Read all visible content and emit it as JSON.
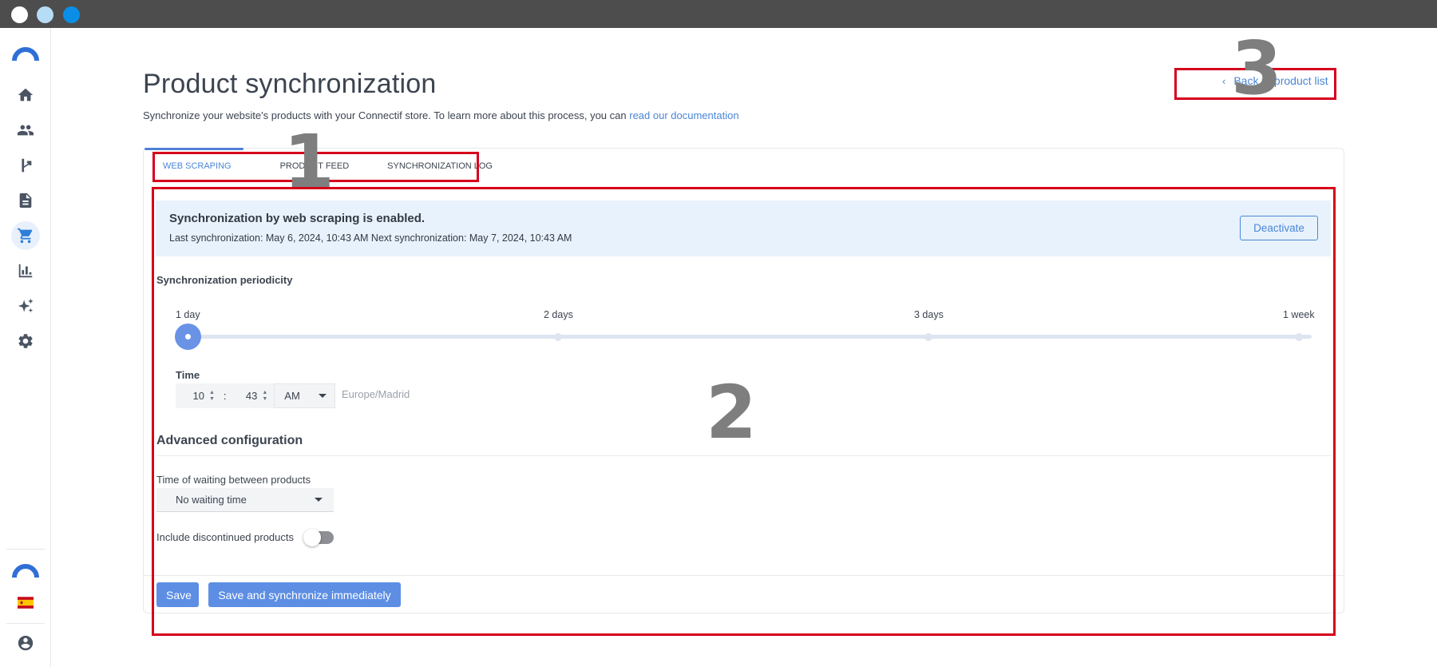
{
  "window": {
    "buttons": [
      "close",
      "minimize",
      "maximize"
    ]
  },
  "sidebar": {
    "items": [
      {
        "icon": "home-icon"
      },
      {
        "icon": "people-icon"
      },
      {
        "icon": "flow-icon"
      },
      {
        "icon": "document-icon"
      },
      {
        "icon": "cart-icon",
        "active": true
      },
      {
        "icon": "chart-icon"
      },
      {
        "icon": "sparkle-icon"
      },
      {
        "icon": "gear-icon"
      }
    ],
    "bottom": [
      {
        "icon": "brand-logo-icon"
      },
      {
        "icon": "spain-flag-icon"
      },
      {
        "icon": "user-avatar-icon"
      }
    ]
  },
  "header": {
    "title": "Product synchronization",
    "subtitle": "Synchronize your website's products with your Connectif store. To learn more about this process, you can",
    "doc_link": "read our documentation",
    "back_link": "Back to product list"
  },
  "tabs": [
    {
      "label": "Web scraping",
      "active": true
    },
    {
      "label": "Product feed",
      "active": false
    },
    {
      "label": "Synchronization log",
      "active": false
    }
  ],
  "banner": {
    "title": "Synchronization by web scraping is enabled.",
    "text": "Last synchronization: May 6, 2024, 10:43 AM Next synchronization: May 7, 2024, 10:43 AM",
    "button": "Deactivate"
  },
  "periodicity": {
    "label": "Synchronization periodicity",
    "options": [
      "1 day",
      "2 days",
      "3 days",
      "1 week"
    ],
    "selected_index": 0
  },
  "time": {
    "label": "Time",
    "hour": "10",
    "minute": "43",
    "separator": ":",
    "ampm": "AM",
    "timezone": "Europe/Madrid"
  },
  "advanced": {
    "title": "Advanced configuration",
    "wait_label": "Time of waiting between products",
    "wait_value": "No waiting time",
    "discontinued_label": "Include discontinued products",
    "discontinued_on": false
  },
  "footer": {
    "save": "Save",
    "save_sync": "Save and synchronize immediately"
  },
  "annotations": [
    "1",
    "2",
    "3"
  ],
  "colors": {
    "accent": "#4a86d6",
    "button": "#5d8ee4",
    "banner_bg": "#e8f2fc",
    "annotation": "#d6001c"
  }
}
